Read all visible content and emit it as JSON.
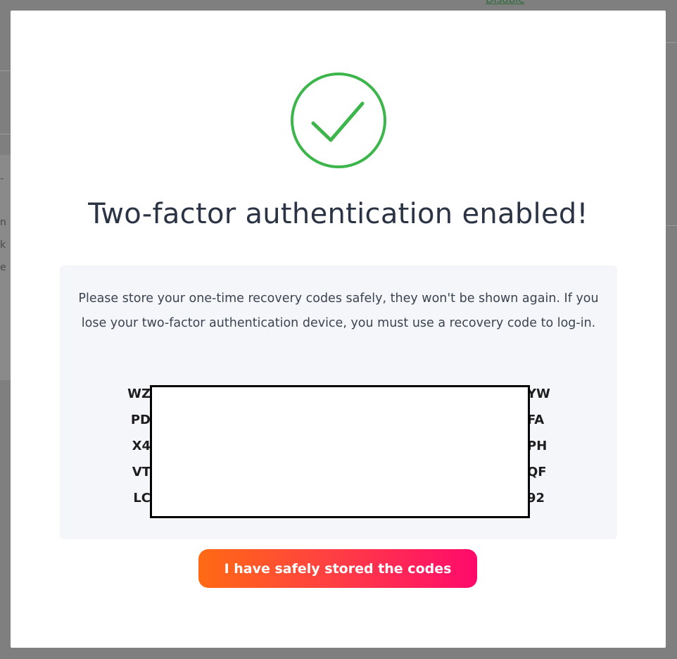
{
  "background": {
    "link_text": "Disable",
    "glyphs": [
      "-",
      "n",
      "k",
      "e"
    ]
  },
  "modal": {
    "title": "Two-factor authentication enabled!",
    "description": "Please store your one-time recovery codes safely, they won't be shown again. If you lose your two-factor authentication device, you must use a recovery code to log-in.",
    "recovery_codes": [
      {
        "start": "WZ",
        "end": "YW"
      },
      {
        "start": "PD",
        "end": "FA"
      },
      {
        "start": "X4",
        "end": "PH"
      },
      {
        "start": "VT",
        "end": "QF"
      },
      {
        "start": "LC",
        "end": "92"
      }
    ],
    "confirm_button": "I have safely stored the codes",
    "success_icon": "check-circle-icon"
  },
  "colors": {
    "success_green": "#3cb54a",
    "title_text": "#2b3445",
    "info_box_bg": "#f4f6fa",
    "button_gradient_start": "#ff6a13",
    "button_gradient_end": "#ff0a6c"
  }
}
